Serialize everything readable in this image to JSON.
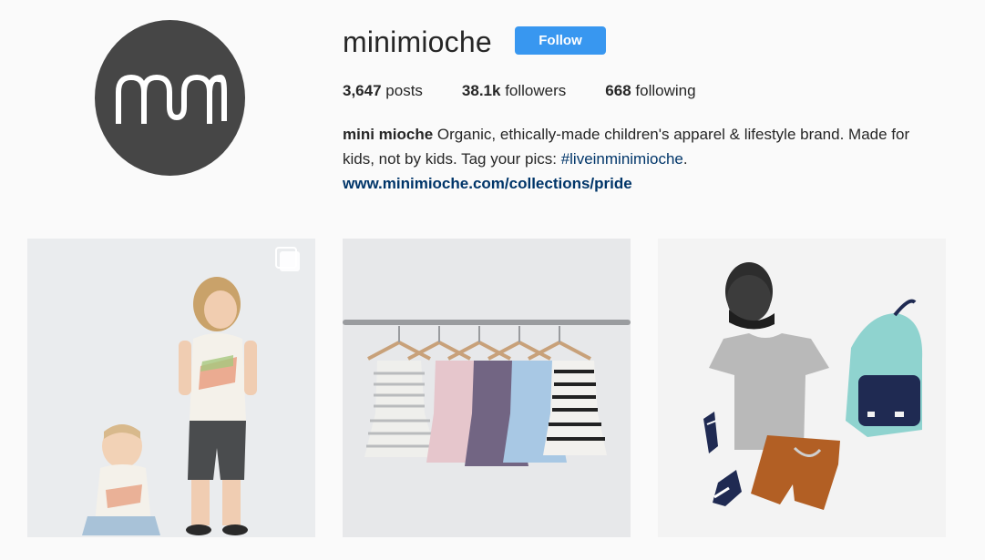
{
  "profile": {
    "username": "minimioche",
    "avatar_icon": "mm-logo-avatar",
    "follow_label": "Follow",
    "stats": {
      "posts_count": "3,647",
      "posts_label": "posts",
      "followers_count": "38.1k",
      "followers_label": "followers",
      "following_count": "668",
      "following_label": "following"
    },
    "bio": {
      "name": "mini mioche",
      "text": " Organic, ethically-made children's apparel & lifestyle brand. Made for kids, not by kids. Tag your pics: ",
      "hashtag": "#liveinminimioche",
      "after_hashtag": ".",
      "link": "www.minimioche.com/collections/pride"
    }
  },
  "posts": [
    {
      "icon": "multiple-posts-icon"
    },
    {},
    {}
  ],
  "colors": {
    "accent": "#3897f0",
    "link": "#003569",
    "avatar_bg": "#464646"
  }
}
